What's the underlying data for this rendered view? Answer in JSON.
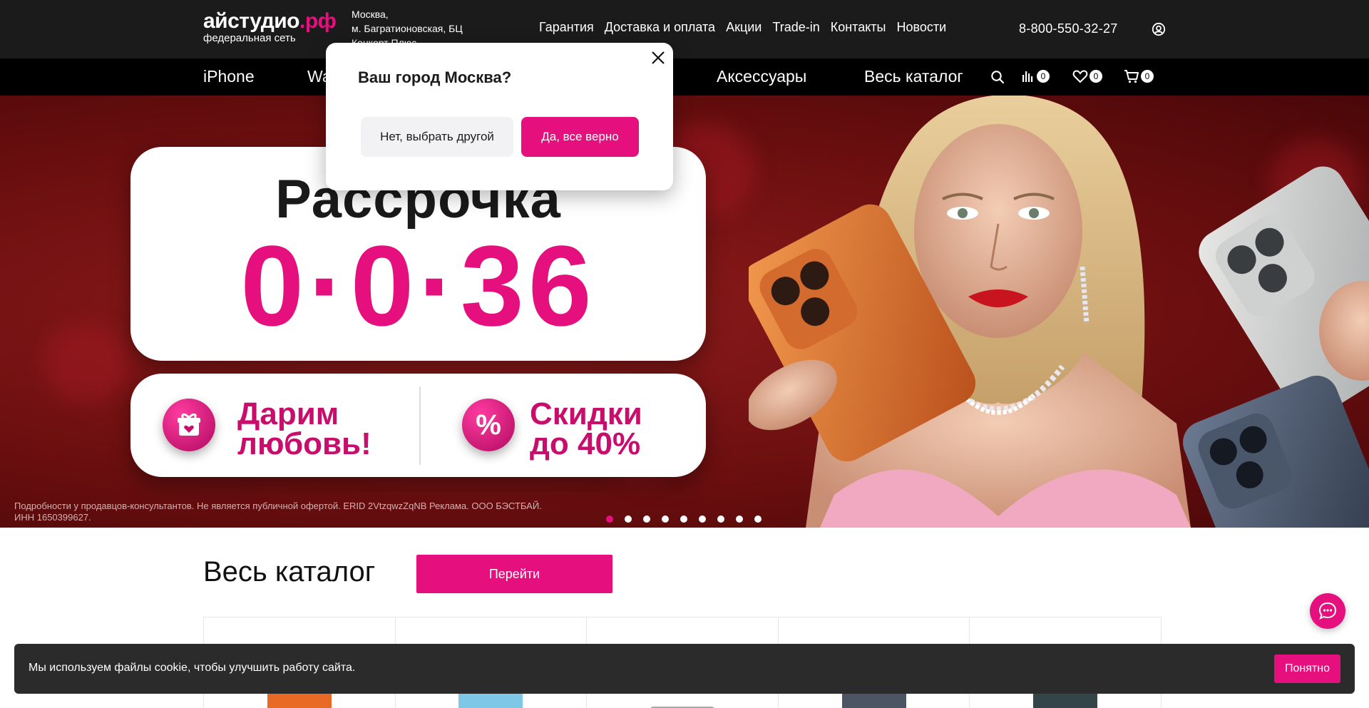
{
  "header": {
    "logo_main": "айстудио",
    "logo_domain": ".рф",
    "logo_sub": "федеральная сеть",
    "address_line1": "Москва,",
    "address_line2": "м. Багратионовская, БЦ",
    "address_line3": "Конкорт Плюс",
    "nav": [
      "Гарантия",
      "Доставка и оплата",
      "Акции",
      "Trade-in",
      "Контакты",
      "Новости"
    ],
    "phone": "8-800-550-32-27",
    "user_icon": "user-circle-icon"
  },
  "main_nav": {
    "items": [
      "iPhone",
      "Wa",
      "Аксессуары",
      "Весь каталог"
    ],
    "compare_count": "0",
    "favorites_count": "0",
    "cart_count": "0"
  },
  "hero": {
    "title": "Рассрочка",
    "rate": "0·0·36",
    "promo1_line1": "Дарим",
    "promo1_line2": "любовь!",
    "promo2_line1": "Скидки",
    "promo2_line2": "до 40%",
    "promo2_icon": "%",
    "disclaimer": "Подробности у продавцов-консультантов. Не является публичной офертой. ERID 2VtzqwzZqNB Реклама. ООО БЭСТБАЙ. ИНН 1650399627.",
    "slides_total": 9,
    "active_slide": 1
  },
  "catalog": {
    "title": "Весь каталог",
    "button": "Перейти"
  },
  "popup": {
    "title": "Ваш город Москва?",
    "no_button": "Нет, выбрать другой",
    "yes_button": "Да, все верно"
  },
  "cookie": {
    "text": "Мы используем файлы cookie, чтобы улучшить работу сайта.",
    "button": "Понятно"
  },
  "colors": {
    "accent": "#e5107d",
    "header_bg": "#1b1b1b",
    "nav_bg": "#000000",
    "hero_bg": "#6d0f10"
  }
}
